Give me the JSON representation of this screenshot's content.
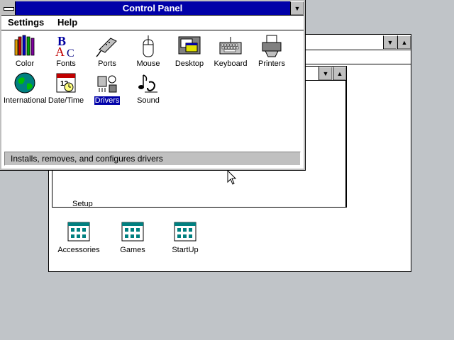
{
  "control_panel": {
    "title": "Control Panel",
    "menus": [
      {
        "label": "Settings"
      },
      {
        "label": "Help"
      }
    ],
    "icons": [
      {
        "label": "Color",
        "icon": "color-icon"
      },
      {
        "label": "Fonts",
        "icon": "fonts-icon"
      },
      {
        "label": "Ports",
        "icon": "ports-icon"
      },
      {
        "label": "Mouse",
        "icon": "mouse-icon"
      },
      {
        "label": "Desktop",
        "icon": "desktop-icon"
      },
      {
        "label": "Keyboard",
        "icon": "keyboard-icon"
      },
      {
        "label": "Printers",
        "icon": "printers-icon"
      },
      {
        "label": "International",
        "icon": "international-icon"
      },
      {
        "label": "Date/Time",
        "icon": "datetime-icon"
      },
      {
        "label": "Drivers",
        "icon": "drivers-icon",
        "selected": true
      },
      {
        "label": "Sound",
        "icon": "sound-icon"
      }
    ],
    "status": "Installs, removes, and configures drivers"
  },
  "program_manager": {
    "groups": [
      {
        "label": "Accessories"
      },
      {
        "label": "Games"
      },
      {
        "label": "StartUp"
      }
    ],
    "main_group": {
      "partial_label": "Setup"
    }
  },
  "colors": {
    "active_title": "#0000a8",
    "desktop": "#c0c4c8",
    "button_face": "#c0c0c0"
  }
}
